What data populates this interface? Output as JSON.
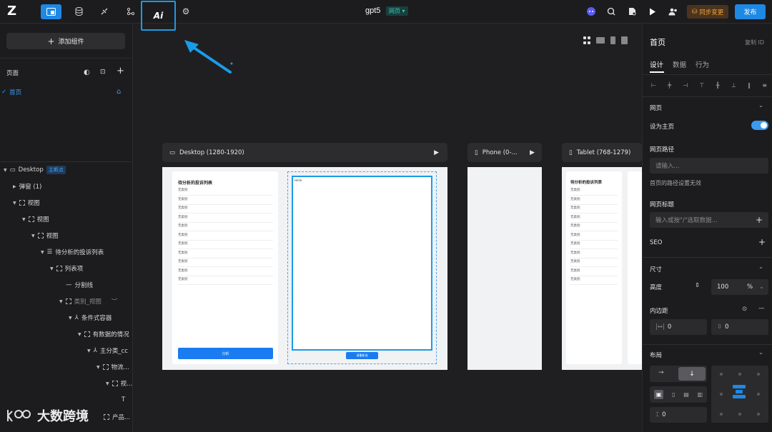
{
  "topbar": {
    "app_title": "gpt5",
    "page_badge": "网页",
    "ai_label": "Ai",
    "sync_label": "同步变更",
    "publish_label": "发布"
  },
  "sidebar": {
    "add_component": "添加组件",
    "pages_title": "页面",
    "pages": [
      {
        "label": "首页"
      }
    ],
    "tree": [
      {
        "label": "Desktop",
        "badge": "主断点"
      },
      {
        "label": "弹窗 (1)"
      },
      {
        "label": "视图"
      },
      {
        "label": "视图"
      },
      {
        "label": "视图"
      },
      {
        "label": "待分析的投诉列表"
      },
      {
        "label": "列表项"
      },
      {
        "label": "分割线"
      },
      {
        "label": "类别_视图"
      },
      {
        "label": "条件式容器"
      },
      {
        "label": "有数据的情况"
      },
      {
        "label": "主分类_cc"
      },
      {
        "label": "物流..."
      },
      {
        "label": "视..."
      },
      {
        "label": "产品..."
      }
    ]
  },
  "canvas": {
    "frames": [
      {
        "label": "Desktop (1280-1920)"
      },
      {
        "label": "Phone (0-..."
      },
      {
        "label": "Tablet (768-1279)"
      }
    ],
    "list_title": "待分析的投诉列表",
    "item_text": "无类别",
    "analyze_btn": "分析",
    "small_btn": "请重新选",
    "tiny_label": "Hello"
  },
  "right_panel": {
    "title": "首页",
    "copy_id": "复制 ID",
    "tabs": [
      {
        "label": "设计"
      },
      {
        "label": "数据"
      },
      {
        "label": "行为"
      }
    ],
    "webpage_section": "网页",
    "set_home": "设为主页",
    "path_label": "网页路径",
    "path_placeholder": "请输入...",
    "path_error": "首页的路径设置无效",
    "page_title_label": "网页标题",
    "page_title_placeholder": "输入或按\"/\"选取数据...",
    "seo": "SEO",
    "size_section": "尺寸",
    "height_label": "高度",
    "height_value": "100",
    "height_unit": "%",
    "padding_label": "内边距",
    "padding_left": "0",
    "padding_right": "0",
    "layout_section": "布局",
    "gap_value": "0"
  },
  "watermark": "大数跨境"
}
